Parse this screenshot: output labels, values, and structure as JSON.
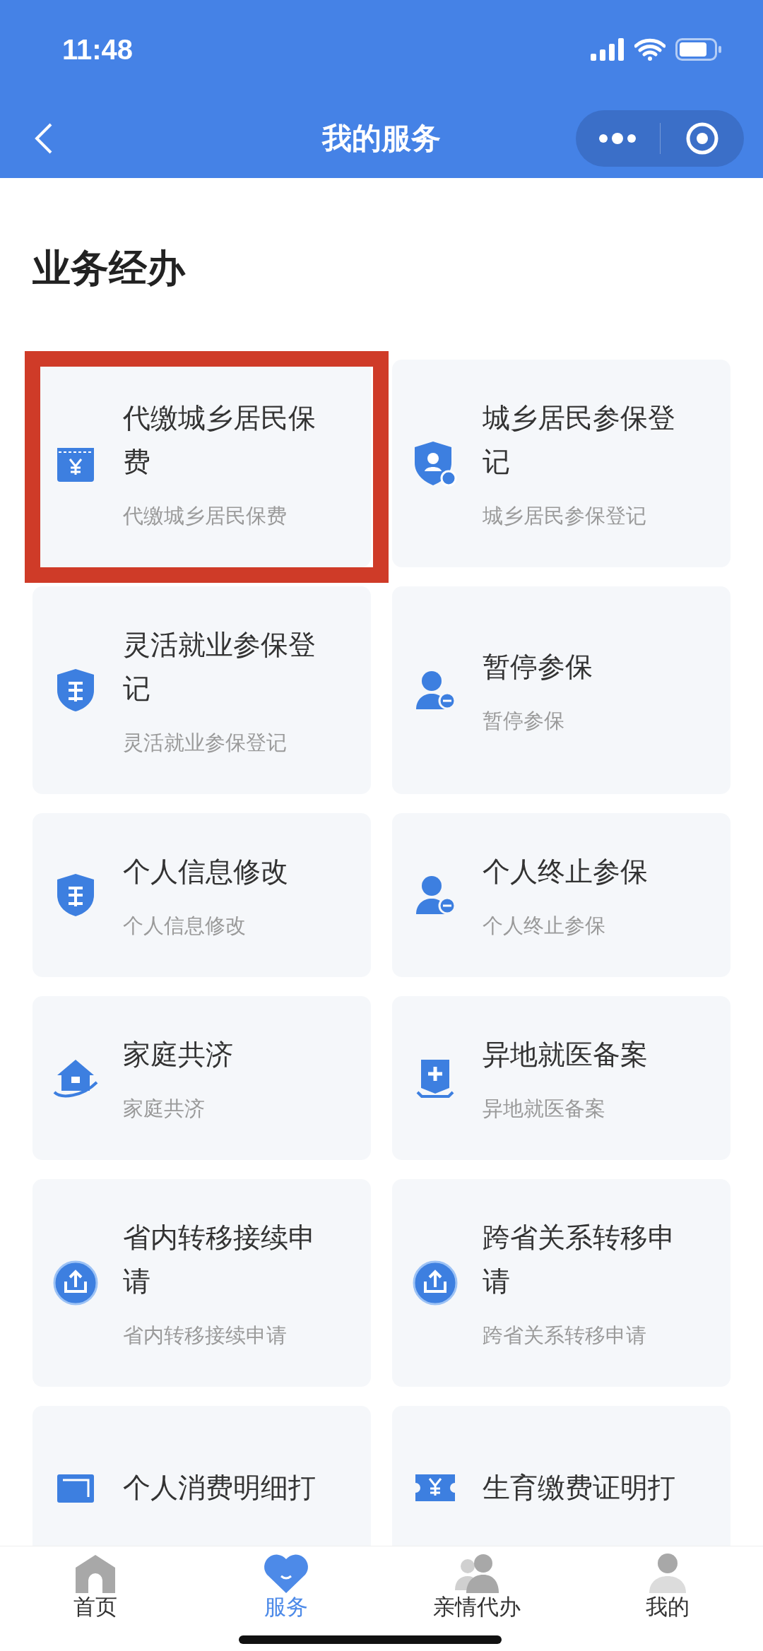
{
  "status_bar": {
    "time": "11:48"
  },
  "nav": {
    "title": "我的服务"
  },
  "section": {
    "title": "业务经办"
  },
  "services": [
    {
      "kind": "wallet",
      "title": "代缴城乡居民保费",
      "subtitle": "代缴城乡居民保费",
      "highlighted": true
    },
    {
      "kind": "shield-person",
      "title": "城乡居民参保登记",
      "subtitle": "城乡居民参保登记",
      "highlighted": false
    },
    {
      "kind": "shield",
      "title": "灵活就业参保登记",
      "subtitle": "灵活就业参保登记",
      "highlighted": false
    },
    {
      "kind": "person-minus",
      "title": "暂停参保",
      "subtitle": "暂停参保",
      "highlighted": false
    },
    {
      "kind": "shield",
      "title": "个人信息修改",
      "subtitle": "个人信息修改",
      "highlighted": false
    },
    {
      "kind": "person-minus",
      "title": "个人终止参保",
      "subtitle": "个人终止参保",
      "highlighted": false
    },
    {
      "kind": "house",
      "title": "家庭共济",
      "subtitle": "家庭共济",
      "highlighted": false
    },
    {
      "kind": "medical",
      "title": "异地就医备案",
      "subtitle": "异地就医备案",
      "highlighted": false
    },
    {
      "kind": "upload",
      "title": "省内转移接续申请",
      "subtitle": "省内转移接续申请",
      "highlighted": false
    },
    {
      "kind": "upload",
      "title": "跨省关系转移申请",
      "subtitle": "跨省关系转移申请",
      "highlighted": false
    },
    {
      "kind": "card",
      "title": "个人消费明细打",
      "highlighted": false
    },
    {
      "kind": "ticket",
      "title": "生育缴费证明打",
      "highlighted": false
    }
  ],
  "tabs": [
    {
      "kind": "home",
      "label": "首页",
      "selected": false
    },
    {
      "kind": "heart",
      "label": "服务",
      "selected": true
    },
    {
      "kind": "people",
      "label": "亲情代办",
      "selected": false
    },
    {
      "kind": "person",
      "label": "我的",
      "selected": false
    }
  ]
}
